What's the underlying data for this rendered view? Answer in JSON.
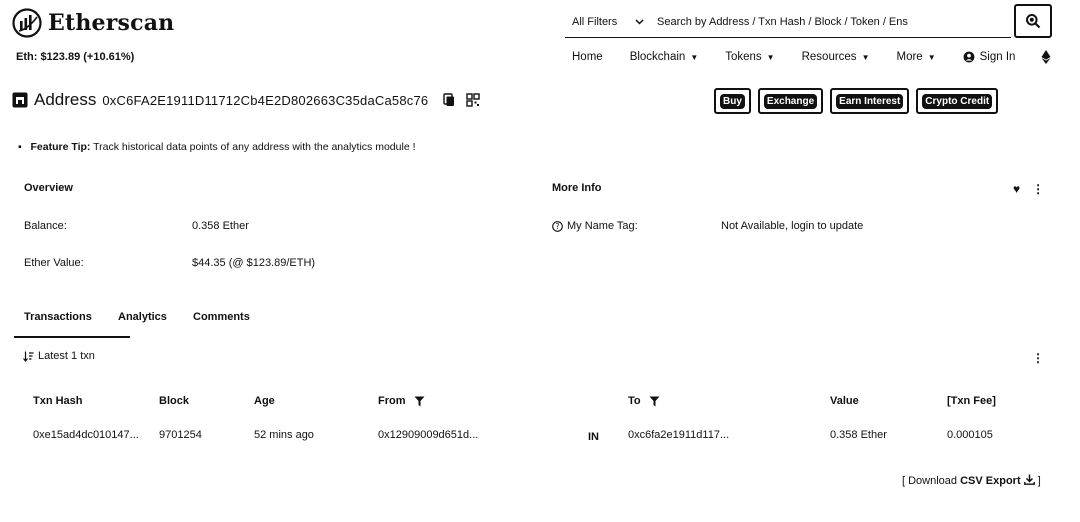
{
  "header": {
    "brand": "Etherscan",
    "eth_price": "Eth: $123.89 (+10.61%)",
    "search": {
      "filter": "All Filters",
      "placeholder": "Search by Address / Txn Hash / Block / Token / Ens"
    },
    "nav": [
      {
        "label": "Home",
        "dropdown": false
      },
      {
        "label": "Blockchain",
        "dropdown": true
      },
      {
        "label": "Tokens",
        "dropdown": true
      },
      {
        "label": "Resources",
        "dropdown": true
      },
      {
        "label": "More",
        "dropdown": true
      },
      {
        "label": "Sign In",
        "dropdown": false
      }
    ]
  },
  "address": {
    "label": "Address",
    "hash": "0xC6FA2E1911D11712Cb4E2D802663C35daCa58c76"
  },
  "actions": [
    "Buy",
    "Exchange",
    "Earn Interest",
    "Crypto Credit"
  ],
  "tip": {
    "bold": "Feature Tip:",
    "text": "Track historical data points of any address with the analytics module !"
  },
  "overview": {
    "title": "Overview",
    "balance_label": "Balance:",
    "balance_value": "0.358 Ether",
    "value_label": "Ether Value:",
    "value_value": "$44.35 (@ $123.89/ETH)"
  },
  "more_info": {
    "title": "More Info",
    "name_tag_label": "My Name Tag:",
    "name_tag_value": "Not Available, login to update"
  },
  "tabs": [
    "Transactions",
    "Analytics",
    "Comments"
  ],
  "txns": {
    "latest": "Latest 1 txn",
    "columns": [
      "Txn Hash",
      "Block",
      "Age",
      "From",
      "To",
      "Value",
      "[Txn Fee]"
    ],
    "rows": [
      {
        "hash": "0xe15ad4dc010147...",
        "block": "9701254",
        "age": "52 mins ago",
        "from": "0x12909009d651d...",
        "direction": "IN",
        "to": "0xc6fa2e1911d117...",
        "value": "0.358 Ether",
        "fee": "0.000105"
      }
    ],
    "csv_prefix": "[ Download ",
    "csv_bold": "CSV Export",
    "csv_suffix": " ]"
  }
}
